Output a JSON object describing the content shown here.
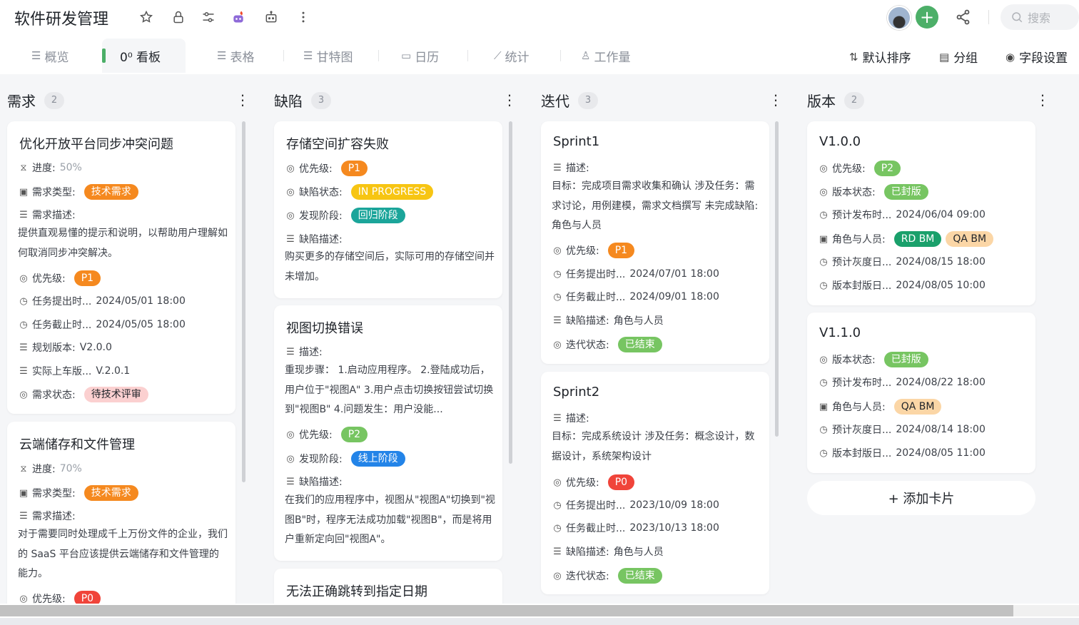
{
  "app": {
    "title": "软件研发管理",
    "search_placeholder": "搜索"
  },
  "tabs": [
    {
      "icon": "list-icon",
      "label": "概览"
    },
    {
      "icon": "board-icon",
      "label": "0⁰ 看板"
    },
    {
      "icon": "table-icon",
      "label": "表格"
    },
    {
      "icon": "gantt-icon",
      "label": "甘特图"
    },
    {
      "icon": "calendar-icon",
      "label": "日历"
    },
    {
      "icon": "chart-icon",
      "label": "统计"
    },
    {
      "icon": "workload-icon",
      "label": "工作量"
    }
  ],
  "toolbar": {
    "sort": "默认排序",
    "group": "分组",
    "fields": "字段设置"
  },
  "columns": [
    {
      "name": "需求",
      "count": "2",
      "cards": [
        {
          "title": "优化开放平台同步冲突问题",
          "progress_label": "进度:",
          "progress": "50%",
          "type_label": "需求类型:",
          "type": "技术需求",
          "desc_label": "需求描述:",
          "desc": "提供直观易懂的提示和说明，以帮助用户理解如何取消同步冲突解决。",
          "priority_label": "优先级:",
          "priority": "P1",
          "submit_label": "任务提出时...",
          "submit": "2024/05/01 18:00",
          "deadline_label": "任务截止时...",
          "deadline": "2024/05/05 18:00",
          "plan_label": "规划版本:",
          "plan": "V2.0.0",
          "actual_label": "实际上车版...",
          "actual": "V.2.0.1",
          "status_label": "需求状态:",
          "status": "待技术评审"
        },
        {
          "title": "云端储存和文件管理",
          "progress_label": "进度:",
          "progress": "70%",
          "type_label": "需求类型:",
          "type": "技术需求",
          "desc_label": "需求描述:",
          "desc": "对于需要同时处理成千上万份文件的企业，我们的 SaaS 平台应该提供云端储存和文件管理的能力。",
          "priority_label": "优先级:",
          "priority": "P0"
        }
      ]
    },
    {
      "name": "缺陷",
      "count": "3",
      "cards": [
        {
          "title": "存储空间扩容失败",
          "priority_label": "优先级:",
          "priority": "P1",
          "state_label": "缺陷状态:",
          "state": "IN PROGRESS",
          "phase_label": "发现阶段:",
          "phase": "回归阶段",
          "desc_label": "缺陷描述:",
          "desc": "购买更多的存储空间后，实际可用的存储空间并未增加。"
        },
        {
          "title": "视图切换错误",
          "desc_label": "描述:",
          "desc": "重现步骤： 1.启动应用程序。 2.登陆成功后，用户位于\"视图A\" 3.用户点击切换按钮尝试切换到\"视图B\" 4.问题发生：用户没能...",
          "priority_label": "优先级:",
          "priority": "P2",
          "phase_label": "发现阶段:",
          "phase": "线上阶段",
          "desc2_label": "缺陷描述:",
          "desc2": "在我们的应用程序中，视图从\"视图A\"切换到\"视图B\"时，程序无法成功加载\"视图B\"，而是将用户重新定向回\"视图A\"。"
        },
        {
          "title": "无法正确跳转到指定日期"
        }
      ]
    },
    {
      "name": "迭代",
      "count": "3",
      "cards": [
        {
          "title": "Sprint1",
          "desc_label": "描述:",
          "desc": "目标：完成项目需求收集和确认 涉及任务：需求讨论，用例建模，需求文档撰写 未完成缺陷:角色与人员",
          "priority_label": "优先级:",
          "priority": "P1",
          "submit_label": "任务提出时...",
          "submit": "2024/07/01 18:00",
          "deadline_label": "任务截止时...",
          "deadline": "2024/09/01 18:00",
          "bug_label": "缺陷描述:",
          "bug": "角色与人员",
          "status_label": "迭代状态:",
          "status": "已结束"
        },
        {
          "title": "Sprint2",
          "desc_label": "描述:",
          "desc": "目标：完成系统设计 涉及任务：概念设计，数据设计，系统架构设计",
          "priority_label": "优先级:",
          "priority": "P0",
          "submit_label": "任务提出时...",
          "submit": "2023/10/09 18:00",
          "deadline_label": "任务截止时...",
          "deadline": "2023/10/13 18:00",
          "bug_label": "缺陷描述:",
          "bug": "角色与人员",
          "status_label": "迭代状态:",
          "status": "已结束"
        }
      ]
    },
    {
      "name": "版本",
      "count": "2",
      "cards": [
        {
          "title": "V1.0.0",
          "priority_label": "优先级:",
          "priority": "P2",
          "state_label": "版本状态:",
          "state": "已封版",
          "release_label": "预计发布时...",
          "release": "2024/06/04 09:00",
          "roles_label": "角色与人员:",
          "role1": "RD BM",
          "role2": "QA BM",
          "gray_label": "预计灰度日...",
          "gray": "2024/08/15 18:00",
          "seal_label": "版本封版日...",
          "seal": "2024/08/05 10:00"
        },
        {
          "title": "V1.1.0",
          "state_label": "版本状态:",
          "state": "已封版",
          "release_label": "预计发布时...",
          "release": "2024/08/22 18:00",
          "roles_label": "角色与人员:",
          "role1": "QA BM",
          "gray_label": "预计灰度日...",
          "gray": "2024/08/14 18:00",
          "seal_label": "版本封版日...",
          "seal": "2024/08/05 11:00"
        }
      ],
      "add_card": "+ 添加卡片"
    }
  ],
  "colors": {
    "accent": "#4caf68",
    "board_bg": "#f5f6f8",
    "p0": "#f0443a",
    "p1": "#f5891f",
    "p2": "#77c562"
  }
}
